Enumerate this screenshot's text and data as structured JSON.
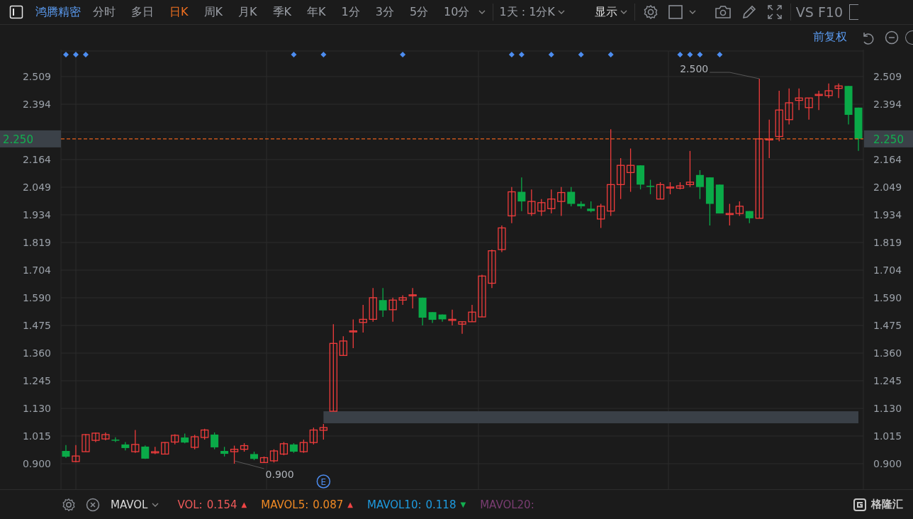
{
  "toolbar": {
    "stock_name": "鸿腾精密",
    "tabs": [
      {
        "label": "分时",
        "selected": false
      },
      {
        "label": "多日",
        "selected": false
      },
      {
        "label": "日K",
        "selected": true
      },
      {
        "label": "周K",
        "selected": false
      },
      {
        "label": "月K",
        "selected": false
      },
      {
        "label": "季K",
        "selected": false
      },
      {
        "label": "年K",
        "selected": false
      },
      {
        "label": "1分",
        "selected": false
      },
      {
        "label": "3分",
        "selected": false
      },
      {
        "label": "5分",
        "selected": false
      },
      {
        "label": "10分",
        "selected": false
      }
    ],
    "range_dropdown": "1天 : 1分K",
    "display_menu": "显示",
    "buttons": [
      "VS",
      "F10"
    ]
  },
  "adjust_label": "前复权",
  "chart": {
    "marked_candles": [
      true,
      true,
      true,
      false,
      false,
      false,
      false,
      false,
      false,
      false,
      false,
      false,
      false,
      false,
      false,
      false,
      false,
      false,
      false,
      false,
      false,
      false,
      false,
      true,
      false,
      false,
      true,
      false,
      false,
      false,
      false,
      false,
      false,
      false,
      true,
      false,
      false,
      false,
      false,
      false,
      false,
      false,
      false,
      false,
      false,
      true,
      true,
      false,
      false,
      true,
      false,
      false,
      true,
      false,
      false,
      true,
      false,
      false,
      false,
      false,
      false,
      false,
      true,
      true,
      true,
      false,
      true,
      false,
      false,
      false,
      false,
      false,
      false,
      false,
      false,
      false,
      false,
      false,
      false,
      false,
      false
    ],
    "left_price_tag": "2.250",
    "event_badge": "E",
    "chart_data": {
      "type": "candlestick",
      "grid": true,
      "ylim": [
        0.9,
        2.509
      ],
      "yticks": [
        {
          "value": 0.9,
          "label": "0.900"
        },
        {
          "value": 1.015,
          "label": "1.015"
        },
        {
          "value": 1.13,
          "label": "1.130"
        },
        {
          "value": 1.245,
          "label": "1.245"
        },
        {
          "value": 1.36,
          "label": "1.360"
        },
        {
          "value": 1.475,
          "label": "1.475"
        },
        {
          "value": 1.59,
          "label": "1.590"
        },
        {
          "value": 1.704,
          "label": "1.704"
        },
        {
          "value": 1.819,
          "label": "1.819"
        },
        {
          "value": 1.934,
          "label": "1.934"
        },
        {
          "value": 2.049,
          "label": "2.049"
        },
        {
          "value": 2.164,
          "label": "2.164"
        },
        {
          "value": 2.394,
          "label": "2.394"
        },
        {
          "value": 2.509,
          "label": "2.509"
        }
      ],
      "ohlc": [
        [
          0.953,
          0.977,
          0.924,
          0.929
        ],
        [
          0.909,
          0.977,
          0.906,
          0.932
        ],
        [
          0.95,
          1.024,
          0.95,
          1.021
        ],
        [
          0.997,
          1.03,
          0.99,
          1.027
        ],
        [
          1.003,
          1.03,
          0.997,
          1.021
        ],
        [
          1.0,
          1.01,
          0.99,
          0.997
        ],
        [
          0.98,
          0.99,
          0.955,
          0.965
        ],
        [
          0.95,
          1.04,
          0.945,
          0.98
        ],
        [
          0.971,
          0.976,
          0.92,
          0.921
        ],
        [
          0.945,
          0.97,
          0.94,
          0.95
        ],
        [
          0.94,
          0.99,
          0.94,
          0.988
        ],
        [
          0.99,
          1.022,
          0.98,
          1.018
        ],
        [
          1.009,
          1.025,
          0.985,
          0.988
        ],
        [
          0.968,
          1.02,
          0.96,
          1.012
        ],
        [
          1.009,
          1.045,
          1.0,
          1.04
        ],
        [
          1.021,
          1.03,
          0.96,
          0.968
        ],
        [
          0.953,
          0.97,
          0.93,
          0.941
        ],
        [
          0.95,
          0.975,
          0.9,
          0.96
        ],
        [
          0.96,
          0.985,
          0.95,
          0.975
        ],
        [
          0.94,
          0.95,
          0.915,
          0.92
        ],
        [
          0.905,
          0.93,
          0.903,
          0.925
        ],
        [
          0.912,
          0.96,
          0.905,
          0.953
        ],
        [
          0.94,
          0.99,
          0.935,
          0.983
        ],
        [
          0.98,
          0.985,
          0.945,
          0.95
        ],
        [
          0.95,
          1.0,
          0.945,
          0.988
        ],
        [
          0.988,
          1.05,
          0.98,
          1.04
        ],
        [
          1.039,
          1.065,
          1.0,
          1.05
        ],
        [
          1.118,
          1.48,
          1.118,
          1.4
        ],
        [
          1.35,
          1.43,
          1.35,
          1.41
        ],
        [
          1.45,
          1.5,
          1.38,
          1.452
        ],
        [
          1.487,
          1.56,
          1.445,
          1.5
        ],
        [
          1.5,
          1.63,
          1.49,
          1.59
        ],
        [
          1.58,
          1.63,
          1.51,
          1.537
        ],
        [
          1.54,
          1.59,
          1.49,
          1.58
        ],
        [
          1.58,
          1.6,
          1.56,
          1.59
        ],
        [
          1.6,
          1.63,
          1.545,
          1.602
        ],
        [
          1.59,
          1.59,
          1.475,
          1.507
        ],
        [
          1.53,
          1.53,
          1.485,
          1.498
        ],
        [
          1.52,
          1.52,
          1.49,
          1.5
        ],
        [
          1.5,
          1.54,
          1.475,
          1.5
        ],
        [
          1.48,
          1.49,
          1.44,
          1.49
        ],
        [
          1.49,
          1.56,
          1.49,
          1.53
        ],
        [
          1.51,
          1.685,
          1.51,
          1.68
        ],
        [
          1.65,
          1.79,
          1.63,
          1.785
        ],
        [
          1.79,
          1.89,
          1.78,
          1.88
        ],
        [
          1.93,
          2.05,
          1.9,
          2.03
        ],
        [
          2.03,
          2.09,
          1.95,
          1.99
        ],
        [
          1.94,
          2.04,
          1.93,
          1.99
        ],
        [
          1.95,
          2.0,
          1.93,
          1.985
        ],
        [
          1.96,
          2.04,
          1.94,
          2.0
        ],
        [
          1.99,
          2.05,
          1.93,
          2.027
        ],
        [
          2.03,
          2.05,
          1.97,
          1.98
        ],
        [
          1.98,
          1.99,
          1.96,
          1.97
        ],
        [
          1.96,
          1.99,
          1.945,
          1.95
        ],
        [
          1.917,
          1.98,
          1.88,
          1.97
        ],
        [
          1.95,
          2.29,
          1.93,
          2.06
        ],
        [
          2.06,
          2.17,
          2.0,
          2.14
        ],
        [
          2.11,
          2.21,
          2.03,
          2.14
        ],
        [
          2.14,
          2.14,
          2.04,
          2.06
        ],
        [
          2.055,
          2.08,
          2.02,
          2.052
        ],
        [
          2.0,
          2.07,
          2.0,
          2.06
        ],
        [
          2.05,
          2.07,
          2.02,
          2.05
        ],
        [
          2.045,
          2.07,
          2.04,
          2.055
        ],
        [
          2.06,
          2.2,
          2.05,
          2.07
        ],
        [
          2.1,
          2.12,
          2.0,
          2.05
        ],
        [
          2.09,
          2.09,
          1.89,
          1.98
        ],
        [
          2.06,
          2.06,
          1.94,
          1.94
        ],
        [
          1.94,
          1.98,
          1.89,
          1.94
        ],
        [
          1.94,
          1.99,
          1.93,
          1.97
        ],
        [
          1.95,
          1.95,
          1.9,
          1.92
        ],
        [
          1.92,
          2.5,
          1.92,
          2.25
        ],
        [
          2.25,
          2.33,
          2.17,
          2.25
        ],
        [
          2.26,
          2.45,
          2.24,
          2.37
        ],
        [
          2.33,
          2.46,
          2.31,
          2.4
        ],
        [
          2.41,
          2.46,
          2.37,
          2.42
        ],
        [
          2.38,
          2.42,
          2.33,
          2.42
        ],
        [
          2.435,
          2.45,
          2.37,
          2.435
        ],
        [
          2.43,
          2.48,
          2.42,
          2.45
        ],
        [
          2.46,
          2.48,
          2.42,
          2.47
        ],
        [
          2.47,
          2.47,
          2.31,
          2.35
        ],
        [
          2.38,
          2.38,
          2.2,
          2.25
        ]
      ],
      "ref_lines": [
        {
          "axis": "y",
          "value": 2.25,
          "label": "2.250",
          "color": "#e8601c"
        }
      ],
      "bands": [
        {
          "axis": "y",
          "from": 1.068,
          "to": 1.118,
          "color": "#3a4047"
        }
      ],
      "annotations": [
        "2.500",
        "0.900"
      ]
    }
  },
  "indicator_bar": {
    "selector": "MAVOL",
    "indicators": [
      {
        "label": "VOL:",
        "value": "0.154",
        "trend": "▲",
        "color": "#f05a5a"
      },
      {
        "label": "MAVOL5:",
        "value": "0.087",
        "trend": "▲",
        "color": "#f08a24"
      },
      {
        "label": "MAVOL10:",
        "value": "0.118",
        "trend": "▼",
        "color": "#1e9be0"
      },
      {
        "label": "MAVOL20:",
        "color": "#7a3d72"
      }
    ],
    "logo": "格隆汇"
  }
}
